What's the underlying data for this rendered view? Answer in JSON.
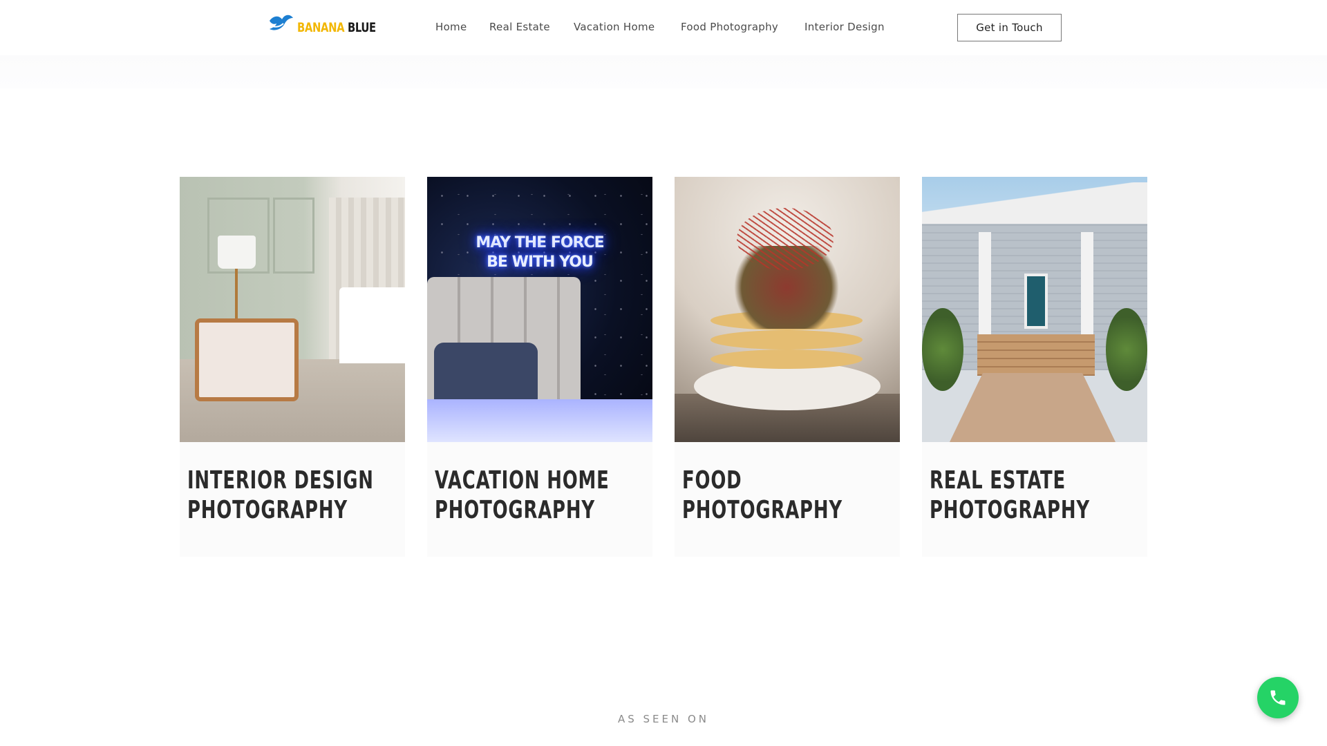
{
  "header": {
    "logo": {
      "word1": "BANANA",
      "word2": "BLUE",
      "icon": "bird-logo-icon"
    },
    "nav": [
      {
        "label": "Home"
      },
      {
        "label": "Real Estate"
      },
      {
        "label": "Vacation Home"
      },
      {
        "label": "Food Photography"
      },
      {
        "label": "Interior Design"
      }
    ],
    "cta_label": "Get in Touch"
  },
  "cards": [
    {
      "line1": "INTERIOR DESIGN",
      "line2": "PHOTOGRAPHY",
      "image": "interior-bedroom-photo"
    },
    {
      "line1": "VACATION HOME",
      "line2": "PHOTOGRAPHY",
      "image": "neon-bedroom-photo",
      "neon_line1": "MAY THE FORCE",
      "neon_line2": "BE WITH YOU"
    },
    {
      "line1": "FOOD",
      "line2": "PHOTOGRAPHY",
      "image": "tostada-dish-photo"
    },
    {
      "line1": "REAL ESTATE",
      "line2": "PHOTOGRAPHY",
      "image": "house-porch-photo"
    }
  ],
  "section": {
    "as_seen_on": "AS SEEN ON"
  },
  "floating": {
    "icon": "phone-icon",
    "color": "#25d366"
  },
  "colors": {
    "logo_yellow": "#f2b705",
    "logo_blue": "#1d7fd1",
    "text_dark": "#2b2b2b"
  }
}
